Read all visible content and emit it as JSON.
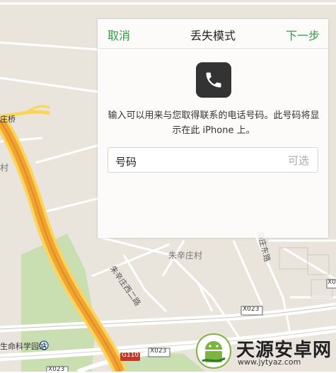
{
  "dialog": {
    "title": "丢失模式",
    "cancel_label": "取消",
    "next_label": "下一步",
    "description": "输入可以用来与您取得联系的电话号码。此号码将显示在此 iPhone 上。",
    "field_label": "号码",
    "field_placeholder": "可选",
    "field_value": ""
  },
  "map": {
    "labels": {
      "zhuang_qiao": "庄桥",
      "cun_left": "村",
      "zhu_xin_zhuang_cun": "朱辛庄村",
      "zhu_xin_zhuang_xi_er_lu": "朱辛庄西二路",
      "xin_zhuang_dong_lu": "辛庄东路",
      "x023_a": "X023",
      "x023_b": "X023",
      "x023_c": "X023",
      "x023_d": "X02",
      "g110": "G110",
      "station": "生命科学园站"
    }
  },
  "watermark": {
    "title": "天源安卓网",
    "url": "www.jytyaz.com"
  },
  "colors": {
    "accent_green": "#2c9e3f",
    "map_bg": "#e9e4dc",
    "highway_orange": "#f0a432",
    "highway_yellow": "#fbd45b",
    "park_green": "#c9dfb1"
  }
}
